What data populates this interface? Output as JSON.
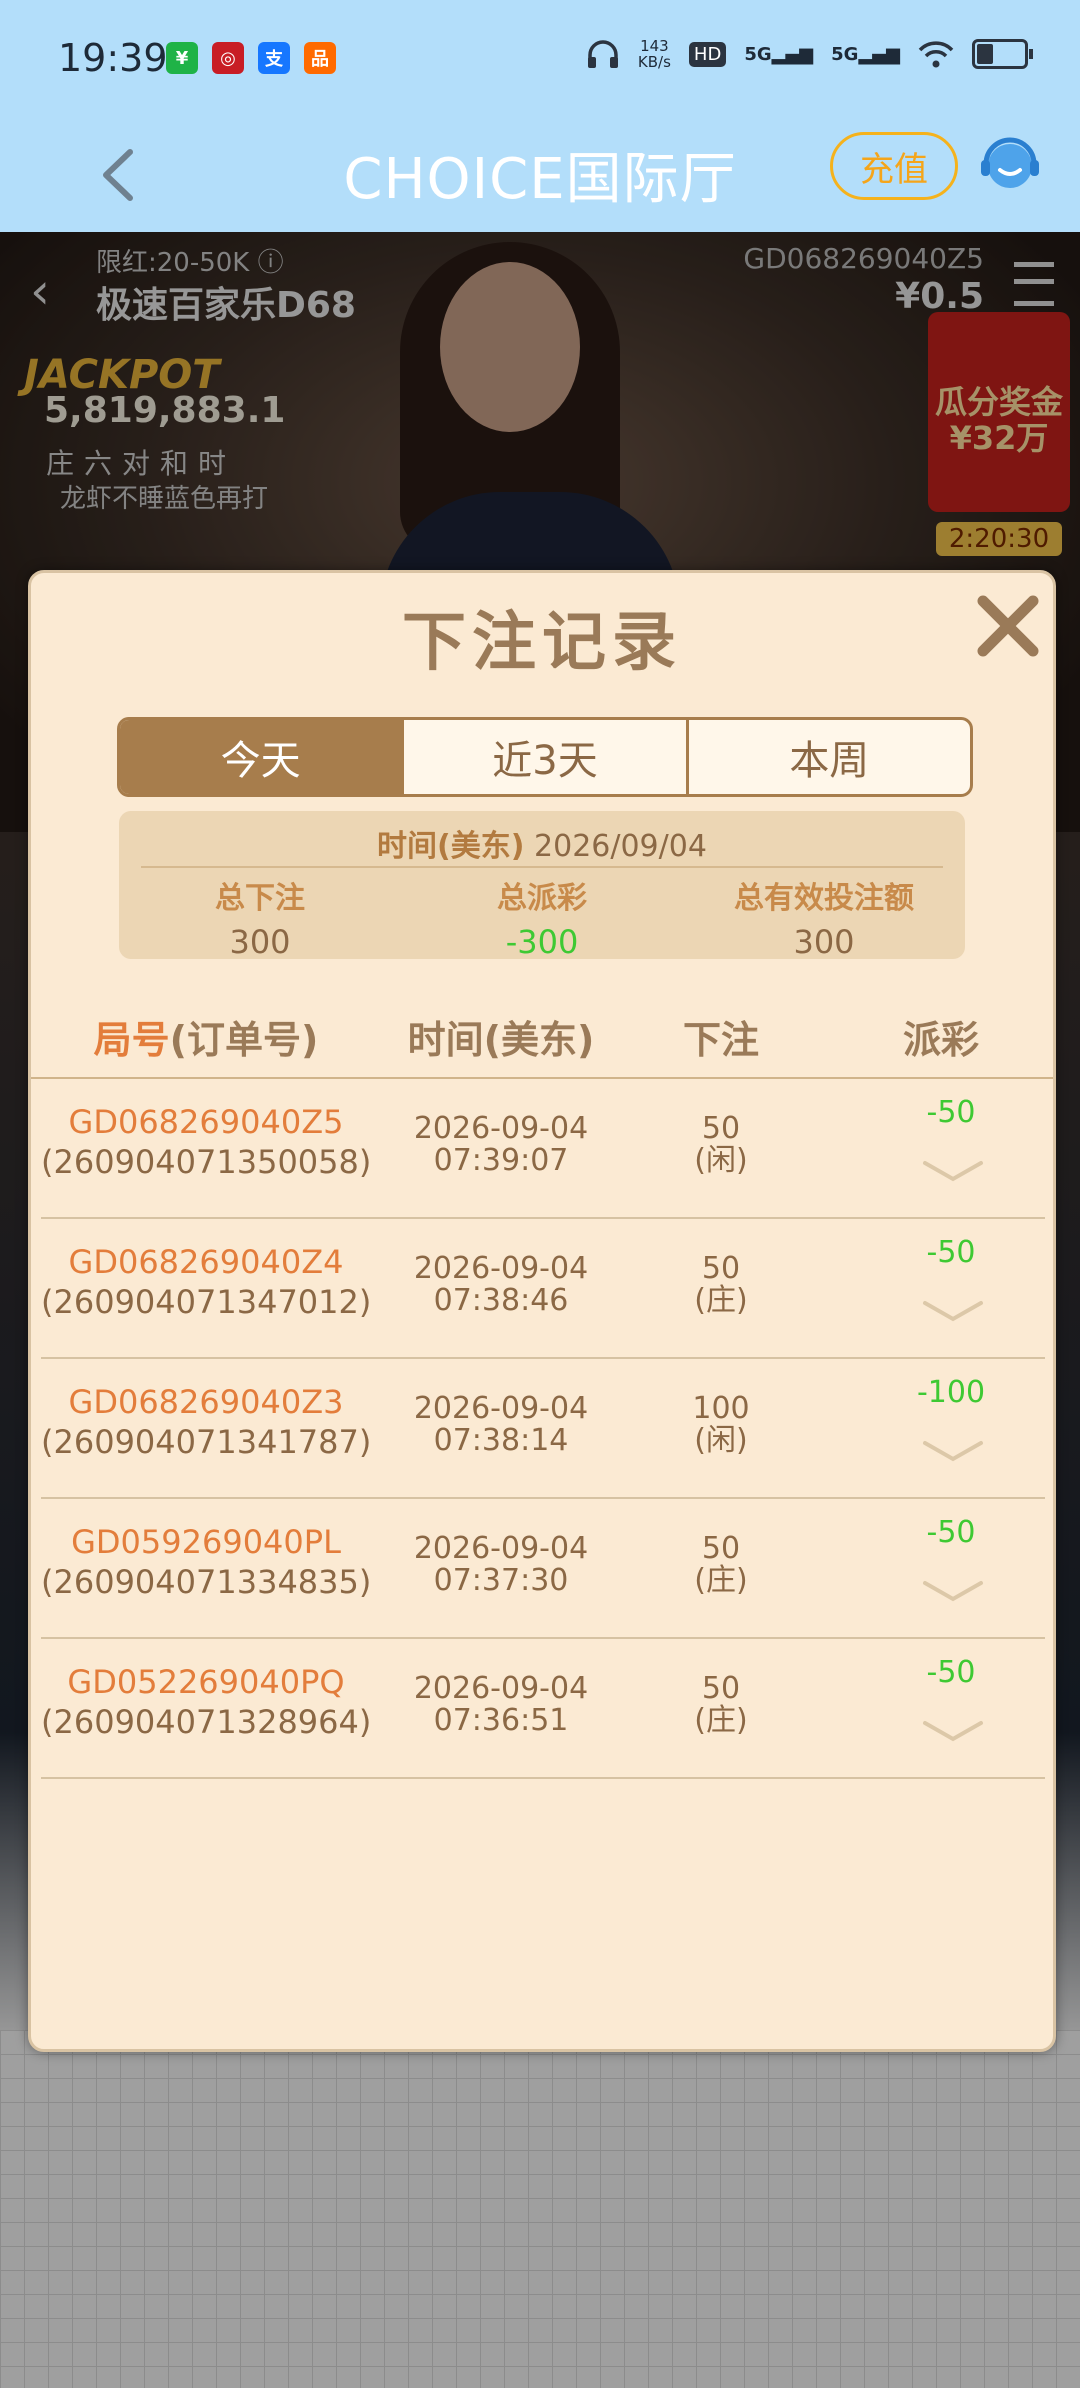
{
  "status_bar": {
    "time": "19:39",
    "apps": [
      {
        "icon": "wechat-pay-icon",
        "glyph": "¥",
        "color": "#1fb347"
      },
      {
        "icon": "bank-icon",
        "glyph": "◎",
        "color": "#c81d25"
      },
      {
        "icon": "alipay-icon",
        "glyph": "支",
        "color": "#1677ff"
      },
      {
        "icon": "taobao-icon",
        "glyph": "品",
        "color": "#ff6a00"
      }
    ],
    "net_speed_value": "143",
    "net_speed_unit": "KB/s",
    "hd_badge": "HD",
    "signal_1": "5G",
    "signal_2": "5G"
  },
  "header": {
    "title": "CHOICE国际厅",
    "recharge_label": "充值"
  },
  "game": {
    "limit": "限红:20-50K ⓘ",
    "table_name": "极速百家乐D68",
    "round_id": "GD068269040Z5",
    "amount": "¥0.5",
    "jackpot_label": "JACKPOT",
    "jackpot_value": "5,819,883.1",
    "bet_types": "庄六对和时",
    "note": "龙虾不睡蓝色再打",
    "red_packet_title": "瓜分奖金",
    "red_packet_amount": "¥32万",
    "red_packet_timer": "2:20:30"
  },
  "modal": {
    "title": "下注记录",
    "tabs": [
      {
        "label": "今天",
        "active": true
      },
      {
        "label": "近3天",
        "active": false
      },
      {
        "label": "本周",
        "active": false
      }
    ],
    "summary": {
      "date_label": "时间(美东)",
      "date_value": "2026/09/04",
      "total_bet_label": "总下注",
      "total_bet_value": "300",
      "total_payout_label": "总派彩",
      "total_payout_value": "-300",
      "valid_bet_label": "总有效投注额",
      "valid_bet_value": "300"
    },
    "columns": {
      "round_accent": "局号",
      "round_rest": "(订单号)",
      "time": "时间(美东)",
      "bet": "下注",
      "payout": "派彩"
    },
    "rows": [
      {
        "round": "GD068269040Z5",
        "order": "(260904071350058)",
        "date": "2026-09-04",
        "time": "07:39:07",
        "bet": "50",
        "side": "(闲)",
        "payout": "-50"
      },
      {
        "round": "GD068269040Z4",
        "order": "(260904071347012)",
        "date": "2026-09-04",
        "time": "07:38:46",
        "bet": "50",
        "side": "(庄)",
        "payout": "-50"
      },
      {
        "round": "GD068269040Z3",
        "order": "(260904071341787)",
        "date": "2026-09-04",
        "time": "07:38:14",
        "bet": "100",
        "side": "(闲)",
        "payout": "-100"
      },
      {
        "round": "GD059269040PL",
        "order": "(260904071334835)",
        "date": "2026-09-04",
        "time": "07:37:30",
        "bet": "50",
        "side": "(庄)",
        "payout": "-50"
      },
      {
        "round": "GD052269040PQ",
        "order": "(260904071328964)",
        "date": "2026-09-04",
        "time": "07:36:51",
        "bet": "50",
        "side": "(庄)",
        "payout": "-50"
      }
    ]
  },
  "colors": {
    "header_bg": "#b3defa",
    "accent_orange": "#e37d3b",
    "payout_green": "#3ec933",
    "tab_active": "#a77d4c",
    "modal_bg": "#fbead3"
  }
}
